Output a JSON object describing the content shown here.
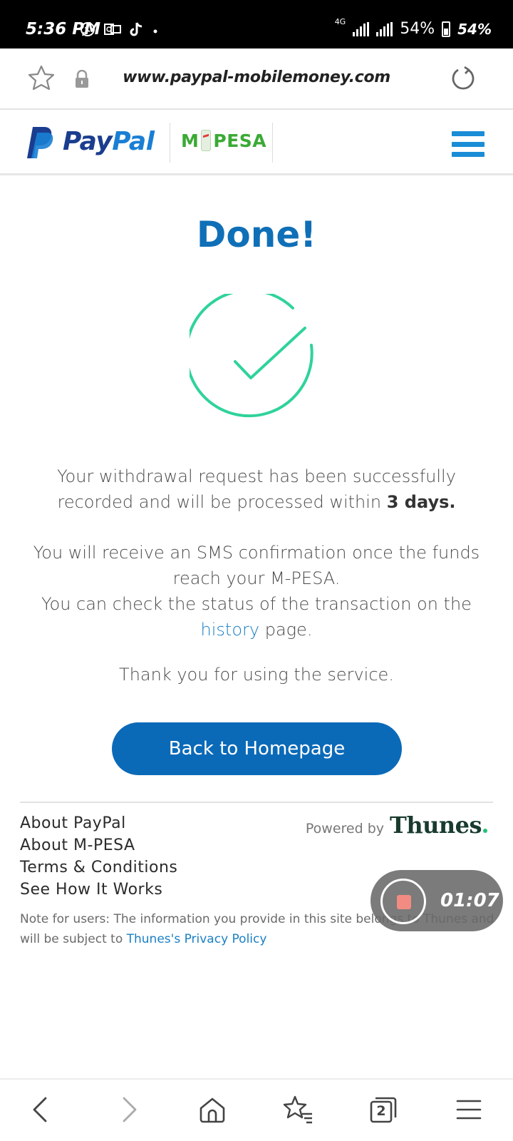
{
  "status_bar": {
    "time": "5:36 PM",
    "network": "4G",
    "battery_text": "54%",
    "battery_percent_right": "54%",
    "icons": [
      "whatsapp-icon",
      "outlook-icon",
      "tiktok-icon",
      "dot-icon",
      "signal-icon",
      "battery-icon"
    ]
  },
  "browser": {
    "url": "www.paypal-mobilemoney.com",
    "tab_count": "2"
  },
  "header": {
    "paypal_text_1": "Pay",
    "paypal_text_2": "Pal",
    "mpesa_left": "M",
    "mpesa_right": "PESA"
  },
  "main": {
    "title": "Done!",
    "message1_a": "Your withdrawal request has been successfully recorded and will be processed within ",
    "message1_bold": "3 days.",
    "message2_a": "You will receive an SMS confirmation once the funds reach your M-PESA.",
    "message2_b": "You can check the status of the transaction on the ",
    "history_link": "history",
    "message2_c": " page.",
    "message3": "Thank you for using the service.",
    "back_button": "Back to Homepage"
  },
  "footer": {
    "links": [
      "About PayPal",
      "About M-PESA",
      "Terms & Conditions",
      "See How It Works"
    ],
    "powered_by": "Powered by",
    "brand": "Thunes",
    "note_a": "Note for users: The information you provide in this site belongs to Thunes and will be subject to ",
    "note_link": "Thunes's Privacy Policy"
  },
  "recording": {
    "time": "01:07"
  },
  "colors": {
    "primary_blue": "#0b6ab8",
    "title_blue": "#0f6fb7",
    "check_green": "#2fd39a",
    "mpesa_green": "#3aaa35"
  }
}
